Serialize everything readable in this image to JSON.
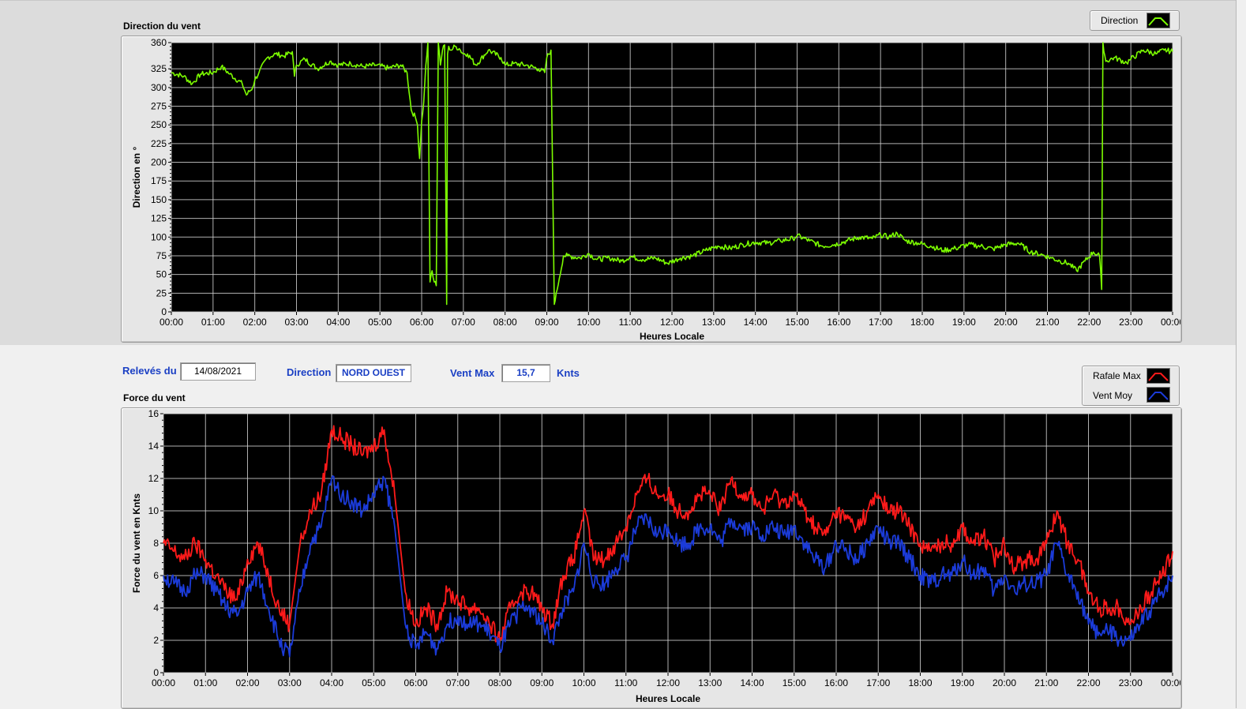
{
  "colors": {
    "direction": "#7CFC00",
    "gust": "#ff1a1a",
    "mean": "#1b3bd9",
    "plot_bg": "#000000",
    "grid": "#cfcfcf",
    "label_blue": "#1a3fc4"
  },
  "top": {
    "title": "Direction du vent",
    "legend": [
      {
        "label": "Direction",
        "icon": "direction-line-icon"
      }
    ]
  },
  "bottom": {
    "title": "Force du vent",
    "legend": [
      {
        "label": "Rafale Max",
        "icon": "gust-line-icon"
      },
      {
        "label": "Vent Moy",
        "icon": "mean-line-icon"
      }
    ]
  },
  "info": {
    "date_label": "Relevés du",
    "date_value": "14/08/2021",
    "direction_label": "Direction",
    "direction_value": "NORD OUEST",
    "vmax_label": "Vent Max",
    "vmax_value": "15,7",
    "vmax_unit": "Knts"
  },
  "chart_data": [
    {
      "type": "line",
      "title": "Direction du vent",
      "xlabel": "Heures Locale",
      "ylabel": "Direction en °",
      "xlim": [
        0,
        24
      ],
      "ylim": [
        0,
        360
      ],
      "yticks": [
        0,
        25,
        50,
        75,
        100,
        125,
        150,
        175,
        200,
        225,
        250,
        275,
        300,
        325,
        360
      ],
      "xtick_labels": [
        "00:00",
        "01:00",
        "02:00",
        "03:00",
        "04:00",
        "05:00",
        "06:00",
        "07:00",
        "08:00",
        "09:00",
        "10:00",
        "11:00",
        "12:00",
        "13:00",
        "14:00",
        "15:00",
        "16:00",
        "17:00",
        "18:00",
        "19:00",
        "20:00",
        "21:00",
        "22:00",
        "23:00",
        "00:00"
      ],
      "grid": true,
      "legend_position": "top-right",
      "series": [
        {
          "name": "Direction",
          "x": [
            0,
            0.3,
            0.5,
            0.7,
            1.0,
            1.2,
            1.4,
            1.7,
            1.8,
            1.95,
            2.0,
            2.1,
            2.3,
            2.5,
            2.7,
            2.9,
            2.95,
            3.0,
            3.2,
            3.5,
            3.8,
            4.0,
            4.3,
            4.6,
            4.9,
            5.2,
            5.5,
            5.65,
            5.75,
            5.85,
            5.9,
            5.95,
            6.0,
            6.05,
            6.1,
            6.15,
            6.2,
            6.25,
            6.3,
            6.35,
            6.4,
            6.45,
            6.5,
            6.55,
            6.6,
            6.62,
            6.65,
            6.7,
            6.8,
            6.9,
            7.0,
            7.1,
            7.3,
            7.6,
            7.9,
            8.0,
            8.2,
            8.5,
            8.8,
            8.95,
            9.0,
            9.1,
            9.18,
            9.2,
            9.25,
            9.3,
            9.4,
            9.5,
            9.8,
            10.0,
            10.2,
            10.5,
            10.8,
            11.0,
            11.3,
            11.6,
            11.9,
            12.2,
            12.5,
            12.8,
            13.1,
            13.4,
            13.7,
            14.0,
            14.3,
            14.6,
            14.9,
            15.0,
            15.3,
            15.6,
            15.9,
            16.2,
            16.5,
            16.8,
            17.0,
            17.2,
            17.4,
            17.6,
            17.9,
            18.2,
            18.5,
            18.8,
            19.1,
            19.4,
            19.7,
            20.0,
            20.3,
            20.6,
            20.9,
            21.1,
            21.3,
            21.5,
            21.7,
            21.9,
            22.1,
            22.25,
            22.3,
            22.33,
            22.4,
            22.6,
            22.9,
            23.0,
            23.3,
            23.6,
            23.8,
            24.0
          ],
          "values": [
            320,
            315,
            305,
            318,
            320,
            328,
            318,
            305,
            290,
            300,
            310,
            320,
            340,
            345,
            342,
            348,
            315,
            330,
            338,
            325,
            335,
            330,
            332,
            328,
            330,
            326,
            330,
            320,
            270,
            260,
            250,
            205,
            255,
            280,
            330,
            360,
            40,
            55,
            40,
            35,
            360,
            330,
            350,
            357,
            10,
            345,
            355,
            350,
            355,
            352,
            345,
            345,
            330,
            350,
            340,
            330,
            332,
            330,
            325,
            320,
            340,
            350,
            10,
            15,
            30,
            45,
            75,
            75,
            72,
            78,
            70,
            72,
            68,
            74,
            70,
            72,
            65,
            72,
            75,
            82,
            88,
            85,
            90,
            93,
            92,
            95,
            98,
            102,
            95,
            88,
            90,
            95,
            100,
            98,
            103,
            100,
            105,
            95,
            92,
            88,
            82,
            85,
            90,
            88,
            84,
            90,
            92,
            80,
            76,
            72,
            68,
            65,
            55,
            68,
            80,
            75,
            30,
            360,
            335,
            340,
            333,
            338,
            350,
            345,
            350,
            348
          ]
        }
      ]
    },
    {
      "type": "line",
      "title": "Force du vent",
      "xlabel": "Heures Locale",
      "ylabel": "Force du vent en Knts",
      "xlim": [
        0,
        24
      ],
      "ylim": [
        0,
        16
      ],
      "yticks": [
        0,
        2,
        4,
        6,
        8,
        10,
        12,
        14,
        16
      ],
      "xtick_labels": [
        "00:00",
        "01:00",
        "02:00",
        "03:00",
        "04:00",
        "05:00",
        "06:00",
        "07:00",
        "08:00",
        "09:00",
        "10:00",
        "11:00",
        "12:00",
        "13:00",
        "14:00",
        "15:00",
        "16:00",
        "17:00",
        "18:00",
        "19:00",
        "20:00",
        "21:00",
        "22:00",
        "23:00",
        "00:00"
      ],
      "grid": true,
      "legend_position": "top-right",
      "series": [
        {
          "name": "Rafale Max",
          "x": [
            0,
            0.25,
            0.5,
            0.75,
            1.0,
            1.25,
            1.5,
            1.75,
            2.0,
            2.25,
            2.5,
            2.75,
            3.0,
            3.25,
            3.5,
            3.75,
            4.0,
            4.25,
            4.5,
            4.75,
            5.0,
            5.25,
            5.5,
            5.75,
            6.0,
            6.25,
            6.5,
            6.75,
            7.0,
            7.25,
            7.5,
            7.75,
            8.0,
            8.25,
            8.5,
            8.75,
            9.0,
            9.25,
            9.5,
            9.75,
            10.0,
            10.25,
            10.5,
            10.75,
            11.0,
            11.25,
            11.5,
            11.75,
            12.0,
            12.25,
            12.5,
            12.75,
            13.0,
            13.25,
            13.5,
            13.75,
            14.0,
            14.25,
            14.5,
            14.75,
            15.0,
            15.25,
            15.5,
            15.75,
            16.0,
            16.25,
            16.5,
            16.75,
            17.0,
            17.25,
            17.5,
            17.75,
            18.0,
            18.25,
            18.5,
            18.75,
            19.0,
            19.25,
            19.5,
            19.75,
            20.0,
            20.25,
            20.5,
            20.75,
            21.0,
            21.25,
            21.5,
            21.75,
            22.0,
            22.25,
            22.5,
            22.75,
            23.0,
            23.25,
            23.5,
            23.75,
            24.0
          ],
          "values": [
            8,
            7.5,
            7,
            8,
            7,
            6,
            5,
            4.5,
            7,
            8,
            6,
            4,
            3,
            8,
            10,
            11,
            15,
            14.5,
            14,
            13.5,
            14,
            15,
            11,
            5,
            3,
            4,
            3,
            5,
            4.5,
            4,
            4,
            3,
            2,
            4,
            5,
            5,
            4,
            3,
            6,
            7,
            10,
            7,
            7,
            8,
            9,
            11,
            12,
            11,
            11,
            10,
            10,
            11,
            11,
            10,
            12,
            11,
            11,
            10,
            11,
            10.5,
            11,
            10,
            9,
            8.5,
            10,
            9.5,
            9,
            10,
            11,
            10,
            10,
            9,
            8,
            7.5,
            8,
            8,
            9,
            8,
            8.5,
            7,
            8,
            6.5,
            7,
            7,
            8,
            10,
            8,
            7,
            5,
            4,
            4,
            4,
            3,
            4,
            5,
            6,
            7.5
          ]
        },
        {
          "name": "Vent Moy",
          "x": [
            0,
            0.25,
            0.5,
            0.75,
            1.0,
            1.25,
            1.5,
            1.75,
            2.0,
            2.25,
            2.5,
            2.75,
            3.0,
            3.25,
            3.5,
            3.75,
            4.0,
            4.25,
            4.5,
            4.75,
            5.0,
            5.25,
            5.5,
            5.75,
            6.0,
            6.25,
            6.5,
            6.75,
            7.0,
            7.25,
            7.5,
            7.75,
            8.0,
            8.25,
            8.5,
            8.75,
            9.0,
            9.25,
            9.5,
            9.75,
            10.0,
            10.25,
            10.5,
            10.75,
            11.0,
            11.25,
            11.5,
            11.75,
            12.0,
            12.25,
            12.5,
            12.75,
            13.0,
            13.25,
            13.5,
            13.75,
            14.0,
            14.25,
            14.5,
            14.75,
            15.0,
            15.25,
            15.5,
            15.75,
            16.0,
            16.25,
            16.5,
            16.75,
            17.0,
            17.25,
            17.5,
            17.75,
            18.0,
            18.25,
            18.5,
            18.75,
            19.0,
            19.25,
            19.5,
            19.75,
            20.0,
            20.25,
            20.5,
            20.75,
            21.0,
            21.25,
            21.5,
            21.75,
            22.0,
            22.25,
            22.5,
            22.75,
            23.0,
            23.25,
            23.5,
            23.75,
            24.0
          ],
          "values": [
            6,
            5.5,
            5,
            6,
            6,
            5,
            4,
            3.5,
            5,
            6,
            4,
            2,
            1,
            5,
            8,
            9,
            12,
            11,
            10.5,
            10,
            11,
            12,
            9,
            3,
            1.5,
            2.5,
            1.5,
            3,
            3.5,
            3,
            3,
            2.5,
            1.5,
            3,
            4,
            4,
            3,
            2,
            4,
            5,
            8,
            5.5,
            5.5,
            6.5,
            7,
            9,
            9.5,
            8.5,
            9,
            8,
            8,
            9,
            9,
            8,
            9.5,
            9,
            9,
            8.5,
            9,
            8.5,
            9,
            8,
            7,
            6.5,
            8,
            7.5,
            7,
            8,
            9,
            8,
            8,
            7,
            6,
            5.5,
            6,
            6,
            7,
            6,
            6.5,
            5,
            6,
            5,
            5.5,
            5.5,
            6,
            8,
            6,
            5,
            3,
            2.5,
            2.5,
            2,
            2,
            3,
            4,
            5,
            6
          ]
        }
      ]
    }
  ]
}
